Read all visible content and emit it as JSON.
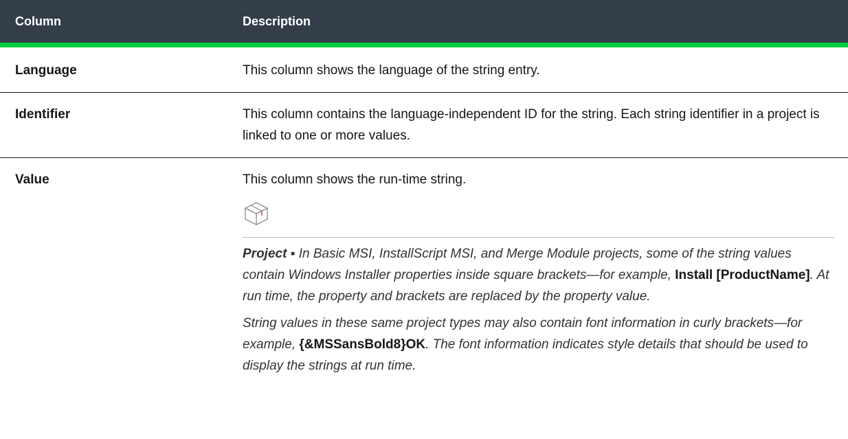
{
  "header": {
    "column": "Column",
    "description": "Description"
  },
  "rows": [
    {
      "name": "Language",
      "description": "This column shows the language of the string entry."
    },
    {
      "name": "Identifier",
      "description": "This column contains the language-independent ID for the string. Each string identifier in a project is linked to one or more values."
    },
    {
      "name": "Value",
      "description": "This column shows the run-time string."
    }
  ],
  "note": {
    "icon": "project-box-icon",
    "label": "Project ▪",
    "p1_before": " In Basic MSI, InstallScript MSI, and Merge Module projects, some of the string values contain Windows Installer properties inside square brackets—for example, ",
    "p1_code": "Install [ProductName]",
    "p1_after": ". At run time, the property and brackets are replaced by the property value.",
    "p2_before": "String values in these same project types may also contain font information in curly brackets—for example, ",
    "p2_code": "{&MSSansBold8}OK",
    "p2_after": ". The font information indicates style details that should be used to display the strings at run time."
  },
  "colors": {
    "header_bg": "#333e48",
    "header_accent": "#00ce3c"
  }
}
